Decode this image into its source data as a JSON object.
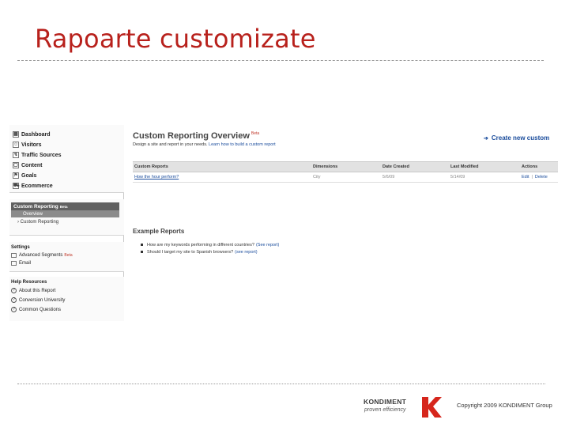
{
  "slide": {
    "title": "Rapoarte customizate",
    "copyright": "Copyright 2009 KONDIMENT Group"
  },
  "logo": {
    "name": "KONDIMENT",
    "tagline": "proven efficiency",
    "accent_color": "#d6261c"
  },
  "sidebar": {
    "nav_items": [
      {
        "label": "Dashboard",
        "icon": "dashboard-icon"
      },
      {
        "label": "Visitors",
        "icon": "visitors-icon"
      },
      {
        "label": "Traffic Sources",
        "icon": "traffic-sources-icon"
      },
      {
        "label": "Content",
        "icon": "content-icon"
      },
      {
        "label": "Goals",
        "icon": "goals-flag-icon"
      },
      {
        "label": "Ecommerce",
        "icon": "ecommerce-cart-icon"
      }
    ],
    "custom_reporting": {
      "label": "Custom Reporting",
      "badge": "Beta",
      "overview": "Overview",
      "sub_item": "Custom Reporting"
    },
    "settings": {
      "title": "Settings",
      "items": [
        {
          "label": "Advanced Segments",
          "badge": "Beta"
        },
        {
          "label": "Email"
        }
      ]
    },
    "help": {
      "title": "Help Resources",
      "items": [
        {
          "label": "About this Report"
        },
        {
          "label": "Conversion University"
        },
        {
          "label": "Common Questions"
        }
      ]
    }
  },
  "main": {
    "title": "Custom Reporting Overview",
    "title_badge": "Beta",
    "description": "Design a site and report in your needs.",
    "learn_link": "Learn how to build a custom report",
    "create_button": "Create new custom",
    "table": {
      "headers": [
        "Custom Reports",
        "Dimensions",
        "Date Created",
        "Last Modified",
        "Actions"
      ],
      "rows": [
        {
          "name": "How the hour perform?",
          "dimensions": "City",
          "created": "5/6/09",
          "modified": "5/14/09",
          "edit": "Edit",
          "delete": "Delete"
        }
      ]
    },
    "examples": {
      "title": "Example Reports",
      "items": [
        {
          "text": "How are my keywords performing in different countries?",
          "link": "(See report)"
        },
        {
          "text": "Should I target my site to Spanish browsers?",
          "link": "(see report)"
        }
      ]
    }
  }
}
